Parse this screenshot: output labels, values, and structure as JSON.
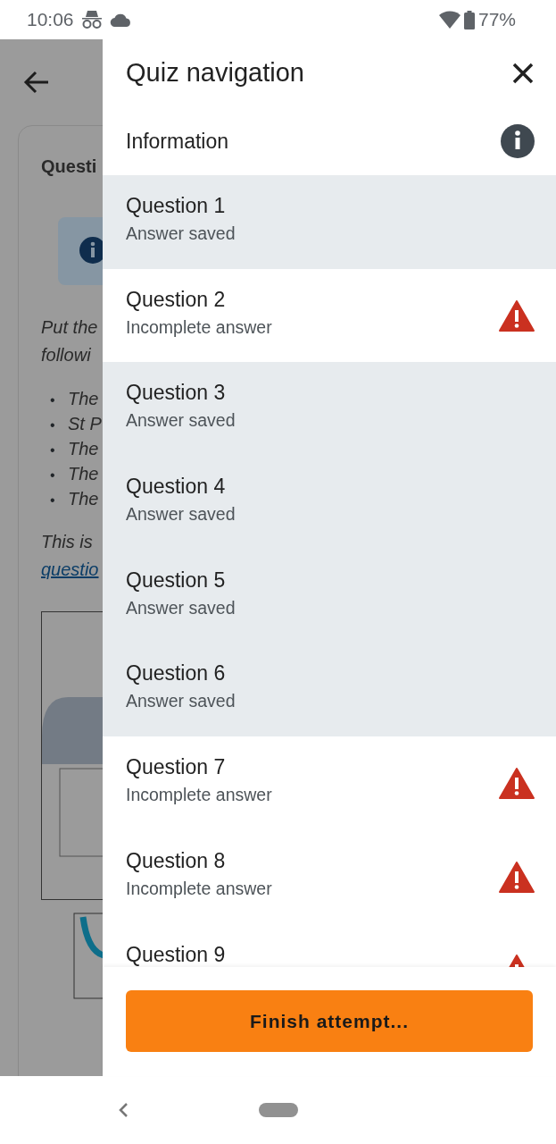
{
  "status_bar": {
    "time": "10:06",
    "battery": "77%"
  },
  "background_page": {
    "card_title": "Questi",
    "prompt_lines": [
      "Put the",
      "followi"
    ],
    "bullets": [
      {
        "marker": "•",
        "text": "The"
      },
      {
        "marker": "•",
        "text": "St P"
      },
      {
        "marker": "•",
        "text": "The"
      },
      {
        "marker": "•",
        "text": "The"
      },
      {
        "marker": "•",
        "text": "The"
      }
    ],
    "note": "This is",
    "link": "questio"
  },
  "drawer": {
    "title": "Quiz navigation",
    "information": "Information",
    "questions": [
      {
        "title": "Question 1",
        "status": "Answer saved",
        "answered": true
      },
      {
        "title": "Question 2",
        "status": "Incomplete answer",
        "answered": false
      },
      {
        "title": "Question 3",
        "status": "Answer saved",
        "answered": true
      },
      {
        "title": "Question 4",
        "status": "Answer saved",
        "answered": true
      },
      {
        "title": "Question 5",
        "status": "Answer saved",
        "answered": true
      },
      {
        "title": "Question 6",
        "status": "Answer saved",
        "answered": true
      },
      {
        "title": "Question 7",
        "status": "Incomplete answer",
        "answered": false
      },
      {
        "title": "Question 8",
        "status": "Incomplete answer",
        "answered": false
      },
      {
        "title": "Question 9",
        "answered": false
      }
    ],
    "finish_button": "Finish attempt..."
  }
}
